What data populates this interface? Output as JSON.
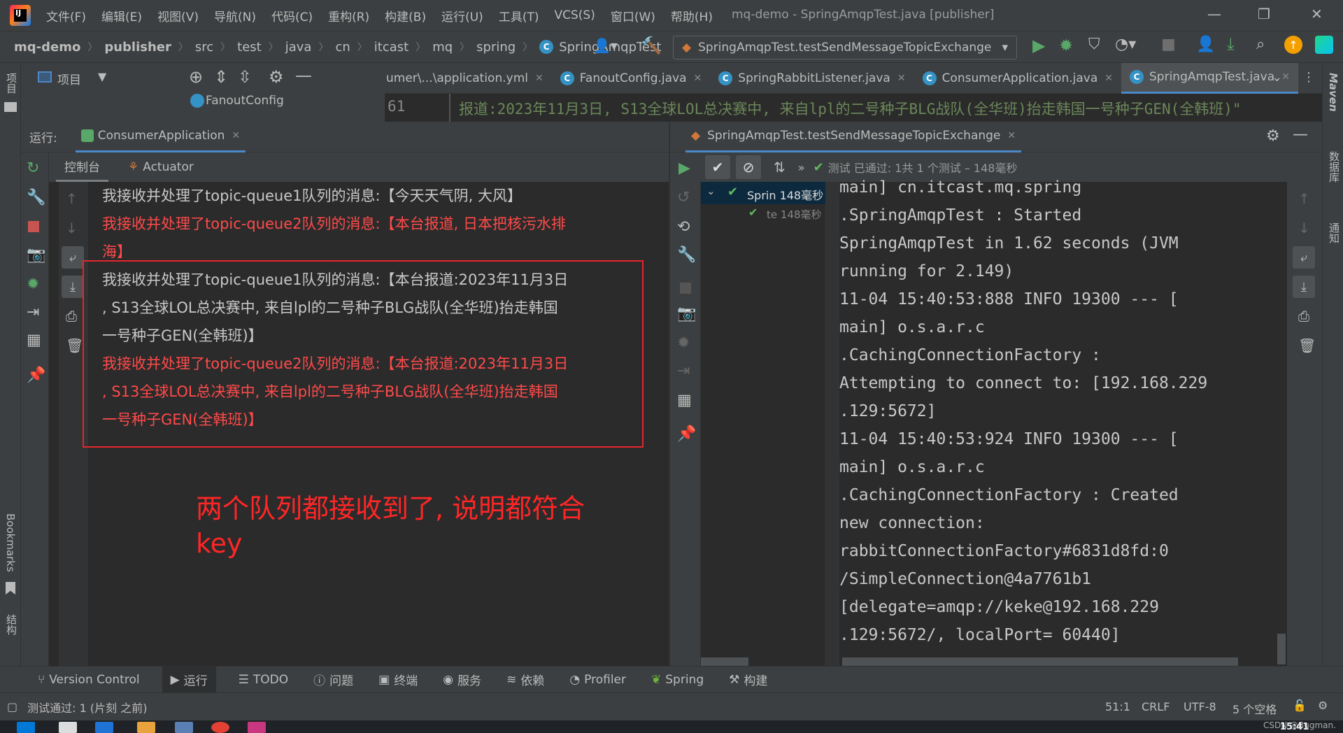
{
  "window": {
    "title": "mq-demo - SpringAmqpTest.java [publisher]"
  },
  "menu": [
    "文件(F)",
    "编辑(E)",
    "视图(V)",
    "导航(N)",
    "代码(C)",
    "重构(R)",
    "构建(B)",
    "运行(U)",
    "工具(T)",
    "VCS(S)",
    "窗口(W)",
    "帮助(H)"
  ],
  "breadcrumbs": [
    "mq-demo",
    "publisher",
    "src",
    "test",
    "java",
    "cn",
    "itcast",
    "mq",
    "spring",
    "SpringAmqpTest"
  ],
  "run_config": "SpringAmqpTest.testSendMessageTopicExchange",
  "project_panel": {
    "label": "项目",
    "structure_item": "FanoutConfig"
  },
  "editor_tabs": [
    {
      "label": "umer\\...\\application.yml",
      "active": false
    },
    {
      "label": "FanoutConfig.java",
      "active": false
    },
    {
      "label": "SpringRabbitListener.java",
      "active": false
    },
    {
      "label": "ConsumerApplication.java",
      "active": false
    },
    {
      "label": "SpringAmqpTest.java",
      "active": true
    }
  ],
  "editor": {
    "line_number": "61",
    "line_text": "报道:2023年11月3日, S13全球LOL总决赛中, 来自lpl的二号种子BLG战队(全华班)抬走韩国一号种子GEN(全韩班)\""
  },
  "run_panel": {
    "label": "运行:",
    "tab": "ConsumerApplication",
    "sub_tabs": [
      "控制台",
      "Actuator"
    ]
  },
  "console_lines": [
    {
      "text": "我接收并处理了topic-queue1队列的消息:【今天天气阴, 大风】",
      "color": "gray"
    },
    {
      "text": "我接收并处理了topic-queue2队列的消息:【本台报道, 日本把核污水排",
      "color": "red"
    },
    {
      "text": "  海】",
      "color": "red"
    },
    {
      "text": "我接收并处理了topic-queue1队列的消息:【本台报道:2023年11月3日",
      "color": "gray"
    },
    {
      "text": "  , S13全球LOL总决赛中, 来自lpl的二号种子BLG战队(全华班)抬走韩国",
      "color": "gray"
    },
    {
      "text": "  一号种子GEN(全韩班)】",
      "color": "gray"
    },
    {
      "text": "我接收并处理了topic-queue2队列的消息:【本台报道:2023年11月3日",
      "color": "red"
    },
    {
      "text": "  , S13全球LOL总决赛中, 来自lpl的二号种子BLG战队(全华班)抬走韩国",
      "color": "red"
    },
    {
      "text": "  一号种子GEN(全韩班)】",
      "color": "red"
    }
  ],
  "annotation": "两个队列都接收到了, 说明都符合key",
  "test_panel": {
    "tab": "SpringAmqpTest.testSendMessageTopicExchange",
    "status": "测试 已通过: 1共 1 个测试 – 148毫秒",
    "tree": [
      {
        "label": "Sprin 148毫秒"
      },
      {
        "label": "te 148毫秒"
      }
    ],
    "output": [
      "    main] cn.itcast.mq.spring",
      " .SpringAmqpTest       : Started",
      " SpringAmqpTest in 1.62 seconds (JVM",
      " running for 2.149)",
      "11-04 15:40:53:888  INFO 19300 --- [",
      "     main] o.s.a.r.c",
      " .CachingConnectionFactory       :",
      " Attempting to connect to: [192.168.229",
      " .129:5672]",
      "11-04 15:40:53:924  INFO 19300 --- [",
      "     main] o.s.a.r.c",
      " .CachingConnectionFactory       : Created",
      "  new connection:",
      " rabbitConnectionFactory#6831d8fd:0",
      " /SimpleConnection@4a7761b1",
      " [delegate=amqp://keke@192.168.229",
      " .129:5672/, localPort= 60440]"
    ]
  },
  "left_strip": {
    "project": "项目",
    "bookmarks": "Bookmarks",
    "structure": "结构"
  },
  "right_strip": {
    "maven": "Maven",
    "database": "数据库",
    "notifications": "通知"
  },
  "bottom_tabs": [
    "Version Control",
    "运行",
    "TODO",
    "问题",
    "终端",
    "服务",
    "依赖",
    "Profiler",
    "Spring",
    "构建"
  ],
  "status": {
    "message": "测试通过: 1 (片刻 之前)",
    "position": "51:1",
    "line_sep": "CRLF",
    "encoding": "UTF-8",
    "indent": "5 个空格"
  },
  "taskbar": {
    "time": "15:41",
    "watermark": "CSDN @Bugman."
  },
  "colors": {
    "accent": "#4a88c7",
    "annotation_red": "#e5252d",
    "success_green": "#5fb85f"
  }
}
